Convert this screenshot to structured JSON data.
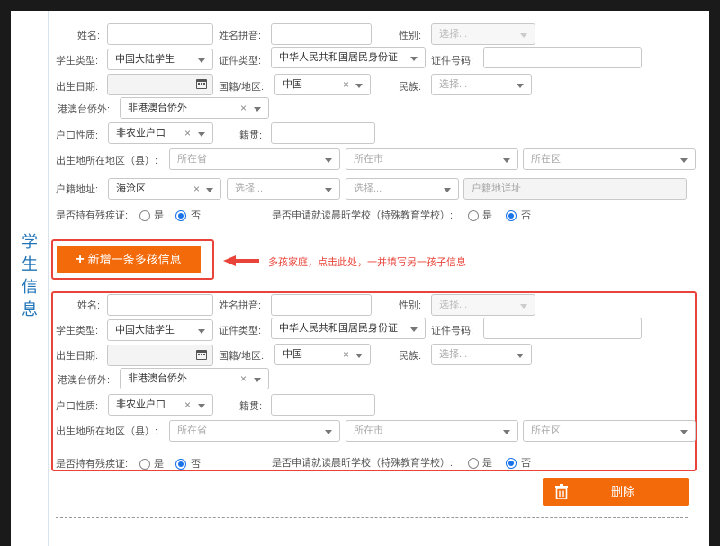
{
  "side_label": "学生信息",
  "side_chars": [
    "学",
    "生",
    "信",
    "息"
  ],
  "labels": {
    "name": "姓名:",
    "pinyin": "姓名拼音:",
    "gender": "性别:",
    "student_type": "学生类型:",
    "id_type": "证件类型:",
    "id_number": "证件号码:",
    "birth_date": "出生日期:",
    "nationality": "国籍/地区:",
    "ethnicity": "民族:",
    "hk_macao_tw": "港澳台侨外:",
    "hukou_type": "户口性质:",
    "native_place": "籍贯:",
    "birthplace": "出生地所在地区（县）:",
    "hukou_address": "户籍地址:",
    "disability": "是否持有残疾证:",
    "special_school": "是否申请就读晨昕学校（特殊教育学校）:",
    "yes": "是",
    "no": "否"
  },
  "values": {
    "select_placeholder": "选择...",
    "student_type": "中国大陆学生",
    "id_type": "中华人民共和国居民身份证",
    "nationality": "中国",
    "hk_macao_tw": "非港澳台侨外",
    "hukou_type": "非农业户口",
    "province_placeholder": "所在省",
    "city_placeholder": "所在市",
    "district_placeholder": "所在区",
    "hukou_district": "海沧区",
    "hukou_detail_placeholder": "户籍地详址",
    "clear_x": "×"
  },
  "buttons": {
    "add_child": "新增一条多孩信息",
    "add_icon": "+",
    "delete": "删除"
  },
  "hint": "多孩家庭，点击此处，一并填写另一孩子信息",
  "colors": {
    "accent": "#f26a0a",
    "annotation": "#e8443a",
    "radio": "#1a73e8",
    "side_text": "#1f73b7"
  }
}
